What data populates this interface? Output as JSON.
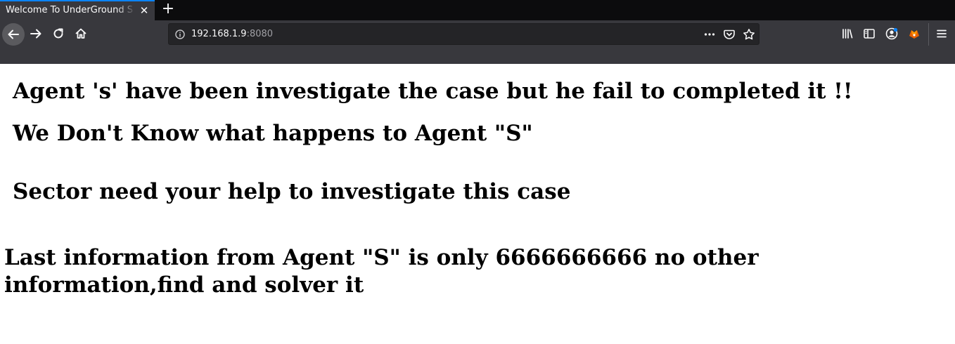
{
  "browser": {
    "tab": {
      "title": "Welcome To UnderGround S",
      "close_glyph": "✕"
    },
    "new_tab_glyph": "+",
    "nav": {
      "back": "arrow-left-icon",
      "forward": "arrow-right-icon",
      "reload": "reload-icon",
      "home": "home-icon"
    },
    "url": {
      "host": "192.168.1.9",
      "port": ":8080"
    },
    "url_actions": [
      "more-icon",
      "pocket-icon",
      "bookmark-star-icon"
    ],
    "toolbar_icons": [
      "library-icon",
      "sidebar-icon",
      "account-icon",
      "extension-icon",
      "menu-icon"
    ],
    "colors": {
      "accent": "#0a84ff",
      "chrome": "#38383d",
      "tabstrip": "#0c0c0d"
    }
  },
  "page": {
    "heading1": "Agent 's' have been investigate the case but he fail to completed it !!",
    "heading2": "We Don't Know what happens to Agent \"S\"",
    "heading3": "Sector need your help to investigate this case",
    "message": "Last information from Agent \"S\" is only 6666666666 no other information,find and solver it"
  }
}
